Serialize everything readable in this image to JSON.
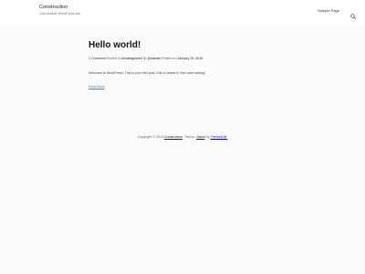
{
  "site": {
    "title": "Construction",
    "description": "Just another WordPress site"
  },
  "nav": {
    "sample_page_label": "Sample Page",
    "search_icon": "search-icon"
  },
  "post": {
    "title": "Hello world!",
    "comments": "1 Comment",
    "posted_in_label": "Posted in",
    "category": "Uncategorized",
    "by_label": "By",
    "author": "jbmarwin",
    "posted_on_label": "Posted on",
    "date": "January 29, 2018",
    "excerpt": "Welcome to WordPress. This is your first post. Edit or delete it, then start writing!",
    "read_more": "Read More"
  },
  "footer": {
    "copyright_prefix": "Copyright © 2018",
    "site_name": "Construction",
    "theme_label": ". Theme:",
    "theme_name": "Zakra",
    "by_label": "By",
    "author": "ThemeGrill."
  },
  "colors": {
    "link_blue": "#2e84c5",
    "background": "#fbfbfb"
  }
}
